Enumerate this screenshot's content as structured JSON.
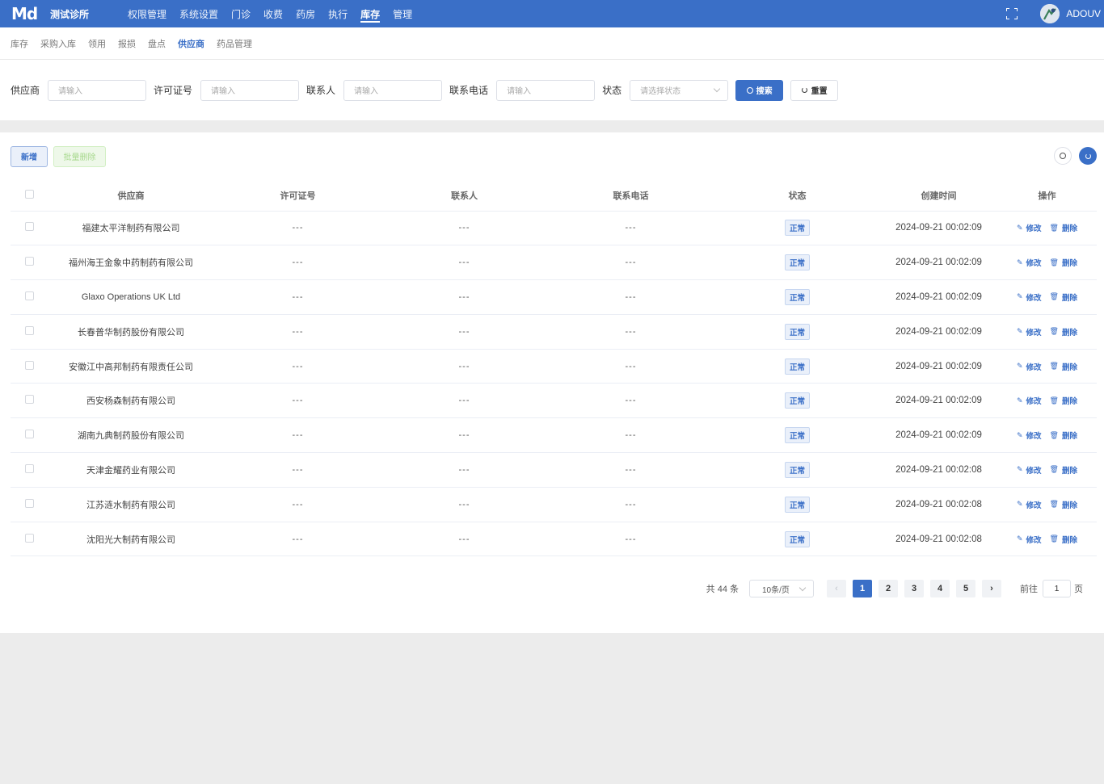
{
  "app": {
    "logo": "Md",
    "clinic_name": "测试诊所",
    "username": "ADOUV"
  },
  "top_menu": [
    {
      "label": "权限管理",
      "active": false
    },
    {
      "label": "系统设置",
      "active": false
    },
    {
      "label": "门诊",
      "active": false
    },
    {
      "label": "收费",
      "active": false
    },
    {
      "label": "药房",
      "active": false
    },
    {
      "label": "执行",
      "active": false
    },
    {
      "label": "库存",
      "active": true
    },
    {
      "label": "管理",
      "active": false
    }
  ],
  "sub_nav": [
    {
      "label": "库存",
      "active": false
    },
    {
      "label": "采购入库",
      "active": false
    },
    {
      "label": "领用",
      "active": false
    },
    {
      "label": "报损",
      "active": false
    },
    {
      "label": "盘点",
      "active": false
    },
    {
      "label": "供应商",
      "active": true
    },
    {
      "label": "药品管理",
      "active": false
    }
  ],
  "filters": {
    "supplier": {
      "label": "供应商",
      "placeholder": "请输入"
    },
    "license": {
      "label": "许可证号",
      "placeholder": "请输入"
    },
    "contact": {
      "label": "联系人",
      "placeholder": "请输入"
    },
    "phone": {
      "label": "联系电话",
      "placeholder": "请输入"
    },
    "status": {
      "label": "状态",
      "placeholder": "请选择状态"
    },
    "search_label": "搜索",
    "reset_label": "重置"
  },
  "toolbar": {
    "add_label": "新增",
    "bulk_delete_label": "批量删除"
  },
  "table": {
    "columns": [
      "供应商",
      "许可证号",
      "联系人",
      "联系电话",
      "状态",
      "创建时间",
      "操作"
    ],
    "edit_label": "修改",
    "delete_label": "删除",
    "rows": [
      {
        "supplier": "福建太平洋制药有限公司",
        "license": "---",
        "contact": "---",
        "phone": "---",
        "status": "正常",
        "created": "2024-09-21 00:02:09"
      },
      {
        "supplier": "福州海王金象中药制药有限公司",
        "license": "---",
        "contact": "---",
        "phone": "---",
        "status": "正常",
        "created": "2024-09-21 00:02:09"
      },
      {
        "supplier": "Glaxo Operations UK Ltd",
        "license": "---",
        "contact": "---",
        "phone": "---",
        "status": "正常",
        "created": "2024-09-21 00:02:09"
      },
      {
        "supplier": "长春普华制药股份有限公司",
        "license": "---",
        "contact": "---",
        "phone": "---",
        "status": "正常",
        "created": "2024-09-21 00:02:09"
      },
      {
        "supplier": "安徽江中高邦制药有限责任公司",
        "license": "---",
        "contact": "---",
        "phone": "---",
        "status": "正常",
        "created": "2024-09-21 00:02:09"
      },
      {
        "supplier": "西安杨森制药有限公司",
        "license": "---",
        "contact": "---",
        "phone": "---",
        "status": "正常",
        "created": "2024-09-21 00:02:09"
      },
      {
        "supplier": "湖南九典制药股份有限公司",
        "license": "---",
        "contact": "---",
        "phone": "---",
        "status": "正常",
        "created": "2024-09-21 00:02:09"
      },
      {
        "supplier": "天津金耀药业有限公司",
        "license": "---",
        "contact": "---",
        "phone": "---",
        "status": "正常",
        "created": "2024-09-21 00:02:08"
      },
      {
        "supplier": "江苏涟水制药有限公司",
        "license": "---",
        "contact": "---",
        "phone": "---",
        "status": "正常",
        "created": "2024-09-21 00:02:08"
      },
      {
        "supplier": "沈阳光大制药有限公司",
        "license": "---",
        "contact": "---",
        "phone": "---",
        "status": "正常",
        "created": "2024-09-21 00:02:08"
      }
    ]
  },
  "pagination": {
    "total_text": "共 44 条",
    "page_size": "10条/页",
    "pages": [
      "1",
      "2",
      "3",
      "4",
      "5"
    ],
    "current": "1",
    "goto_prefix": "前往",
    "goto_value": "1",
    "goto_suffix": "页"
  },
  "colors": {
    "primary": "#3a6fc7",
    "success_light": "#eef8e9"
  }
}
